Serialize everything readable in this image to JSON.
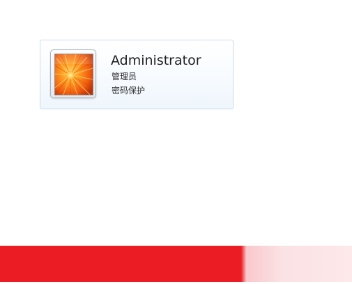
{
  "account": {
    "username": "Administrator",
    "role": "管理员",
    "status": "密码保护",
    "avatar_icon": "flower-avatar-icon"
  },
  "colors": {
    "tile_border": "#c9dcec",
    "banner_red": "#ec1c24"
  }
}
